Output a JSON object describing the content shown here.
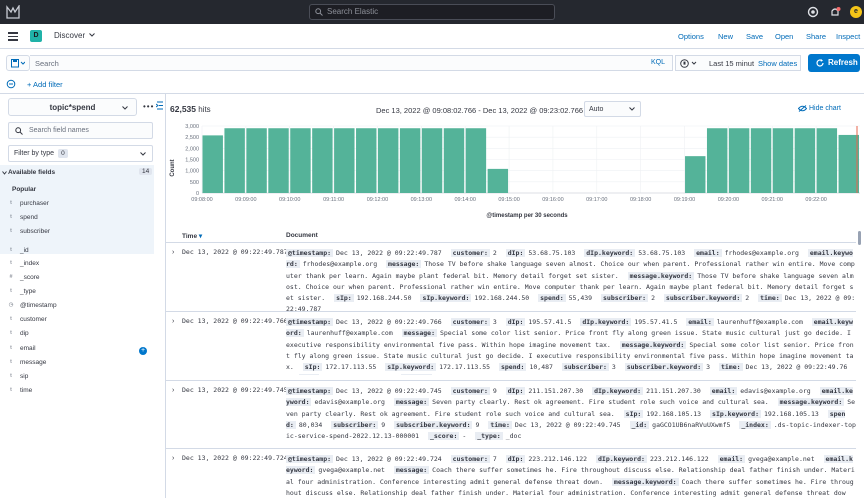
{
  "topbar": {
    "search_placeholder": "Search Elastic",
    "avatar_letter": "e"
  },
  "appbar": {
    "space_letter": "D",
    "title": "Discover",
    "links": [
      "Options",
      "New",
      "Save",
      "Open",
      "Share",
      "Inspect"
    ]
  },
  "querybar": {
    "search_placeholder": "Search",
    "language": "KQL",
    "date_label": "Last 15 minut",
    "show_dates": "Show dates",
    "refresh": "Refresh",
    "add_filter": "+ Add filter"
  },
  "sidebar": {
    "index_pattern": "topic*spend",
    "field_search_placeholder": "Search field names",
    "filter_by_type": "Filter by type",
    "filter_count": "0",
    "available_fields": "Available fields",
    "available_count": "14",
    "popular": "Popular",
    "popular_fields": [
      {
        "type": "t",
        "name": "purchaser"
      },
      {
        "type": "t",
        "name": "spend"
      },
      {
        "type": "t",
        "name": "subscriber"
      }
    ],
    "fields": [
      {
        "type": "t",
        "name": "_id"
      },
      {
        "type": "t",
        "name": "_index"
      },
      {
        "type": "#",
        "name": "_score"
      },
      {
        "type": "t",
        "name": "_type"
      },
      {
        "type": "◷",
        "name": "@timestamp"
      },
      {
        "type": "t",
        "name": "customer"
      },
      {
        "type": "t",
        "name": "dip"
      },
      {
        "type": "t",
        "name": "email"
      },
      {
        "type": "t",
        "name": "message"
      },
      {
        "type": "t",
        "name": "sip"
      },
      {
        "type": "t",
        "name": "time"
      }
    ]
  },
  "main": {
    "hits_count": "62,535",
    "hits_label": " hits",
    "time_range": "Dec 13, 2022 @ 09:08:02.766 - Dec 13, 2022 @ 09:23:02.766",
    "interval": "Auto",
    "hide_chart": "Hide chart",
    "col_time": "Time",
    "col_document": "Document"
  },
  "chart_data": {
    "type": "bar",
    "xlabel": "@timestamp per 30 seconds",
    "ylabel": "Count",
    "ylim": [
      0,
      3000
    ],
    "yticks": [
      "0",
      "500",
      "1,000",
      "1,500",
      "2,000",
      "2,500",
      "3,000"
    ],
    "xticks": [
      "09:08:00",
      "09:09:00",
      "09:10:00",
      "09:11:00",
      "09:12:00",
      "09:13:00",
      "09:14:00",
      "09:15:00",
      "09:16:00",
      "09:17:00",
      "09:18:00",
      "09:19:00",
      "09:20:00",
      "09:21:00",
      "09:22:00"
    ],
    "start_label": "09:08:00",
    "bar_width_minutes": 0.5,
    "bars": [
      {
        "t": 0.0,
        "v": 2580
      },
      {
        "t": 0.5,
        "v": 2900
      },
      {
        "t": 1.0,
        "v": 2900
      },
      {
        "t": 1.5,
        "v": 2900
      },
      {
        "t": 2.0,
        "v": 2900
      },
      {
        "t": 2.5,
        "v": 2900
      },
      {
        "t": 3.0,
        "v": 2900
      },
      {
        "t": 3.5,
        "v": 2900
      },
      {
        "t": 4.0,
        "v": 2900
      },
      {
        "t": 4.5,
        "v": 2900
      },
      {
        "t": 5.0,
        "v": 2900
      },
      {
        "t": 5.5,
        "v": 2900
      },
      {
        "t": 6.0,
        "v": 2900
      },
      {
        "t": 6.5,
        "v": 1080
      },
      {
        "t": 11.0,
        "v": 1650
      },
      {
        "t": 11.5,
        "v": 2900
      },
      {
        "t": 12.0,
        "v": 2900
      },
      {
        "t": 12.5,
        "v": 2900
      },
      {
        "t": 13.0,
        "v": 2900
      },
      {
        "t": 13.5,
        "v": 2900
      },
      {
        "t": 14.0,
        "v": 2900
      },
      {
        "t": 14.5,
        "v": 2600
      }
    ],
    "colors": {
      "bar": "#54b399",
      "now_line": "#e7664c"
    }
  },
  "documents": [
    {
      "time": "Dec 13, 2022 @ 09:22:49.787",
      "fields": [
        [
          "@timestamp:",
          "Dec 13, 2022 @ 09:22:49.787"
        ],
        [
          "customer:",
          "2"
        ],
        [
          "dIp:",
          "53.68.75.103"
        ],
        [
          "dIp.keyword:",
          "53.68.75.103"
        ],
        [
          "email:",
          "frhodes@example.org"
        ],
        [
          "email.keyword:",
          "frhodes@example.org"
        ],
        [
          "message:",
          "Those TV before shake language seven almost. Choice our when parent. Professional rather win entire. Move computer thank per learn. Again maybe plant federal bit. Memory detail forget set sister."
        ],
        [
          "message.keyword:",
          "Those TV before shake language seven almost. Choice our when parent. Professional rather win entire. Move computer thank per learn. Again maybe plant federal bit. Memory detail forget set sister."
        ],
        [
          "sIp:",
          "192.168.244.50"
        ],
        [
          "sIp.keyword:",
          "192.168.244.50"
        ],
        [
          "spend:",
          "55,439"
        ],
        [
          "subscriber:",
          "2"
        ],
        [
          "subscriber.keyword:",
          "2"
        ],
        [
          "time:",
          "Dec 13, 2022 @ 09:22:49.787"
        ]
      ]
    },
    {
      "time": "Dec 13, 2022 @ 09:22:49.766",
      "fields": [
        [
          "@timestamp:",
          "Dec 13, 2022 @ 09:22:49.766"
        ],
        [
          "customer:",
          "3"
        ],
        [
          "dIp:",
          "195.57.41.5"
        ],
        [
          "dIp.keyword:",
          "195.57.41.5"
        ],
        [
          "email:",
          "laurenhuff@example.com"
        ],
        [
          "email.keyword:",
          "laurenhuff@example.com"
        ],
        [
          "message:",
          "Special some color list senior. Price front fly along green issue. State music cultural just go decide. I executive responsibility environmental five pass. Within hope imagine movement tax."
        ],
        [
          "message.keyword:",
          "Special some color list senior. Price front fly along green issue. State music cultural just go decide. I executive responsibility environmental five pass. Within hope imagine movement tax."
        ],
        [
          "sIp:",
          "172.17.113.55"
        ],
        [
          "sIp.keyword:",
          "172.17.113.55"
        ],
        [
          "spend:",
          "10,487"
        ],
        [
          "subscriber:",
          "3"
        ],
        [
          "subscriber.keyword:",
          "3"
        ],
        [
          "time:",
          "Dec 13, 2022 @ 09:22:49.766"
        ],
        [
          "_id:",
          "gcGCO1UBbNWVuXwmT5"
        ],
        [
          "_index:",
          ".ds-"
        ]
      ]
    },
    {
      "time": "Dec 13, 2022 @ 09:22:49.745",
      "fields": [
        [
          "@timestamp:",
          "Dec 13, 2022 @ 09:22:49.745"
        ],
        [
          "customer:",
          "9"
        ],
        [
          "dIp:",
          "211.151.207.30"
        ],
        [
          "dIp.keyword:",
          "211.151.207.30"
        ],
        [
          "email:",
          "edavis@example.org"
        ],
        [
          "email.keyword:",
          "edavis@example.org"
        ],
        [
          "message:",
          "Seven party clearly. Rest ok agreement. Fire student role such voice and cultural sea."
        ],
        [
          "message.keyword:",
          "Seven party clearly. Rest ok agreement. Fire student role such voice and cultural sea."
        ],
        [
          "sIp:",
          "192.168.105.13"
        ],
        [
          "sIp.keyword:",
          "192.168.105.13"
        ],
        [
          "spend:",
          "80,034"
        ],
        [
          "subscriber:",
          "9"
        ],
        [
          "subscriber.keyword:",
          "9"
        ],
        [
          "time:",
          "Dec 13, 2022 @ 09:22:49.745"
        ],
        [
          "_id:",
          "gaGCO1UB6naRVuUXwmf5"
        ],
        [
          "_index:",
          ".ds-topic-indexer-topic-service-spend-2022.12.13-000001"
        ],
        [
          "_score:",
          "-"
        ],
        [
          "_type:",
          "_doc"
        ]
      ]
    },
    {
      "time": "Dec 13, 2022 @ 09:22:49.724",
      "fields": [
        [
          "@timestamp:",
          "Dec 13, 2022 @ 09:22:49.724"
        ],
        [
          "customer:",
          "7"
        ],
        [
          "dIp:",
          "223.212.146.122"
        ],
        [
          "dIp.keyword:",
          "223.212.146.122"
        ],
        [
          "email:",
          "gvega@example.net"
        ],
        [
          "email.keyword:",
          "gvega@example.net"
        ],
        [
          "message:",
          "Coach there suffer sometimes he. Fire throughout discuss else. Relationship deal father finish under. Material four administration. Conference interesting admit general defense threat down."
        ],
        [
          "message.keyword:",
          "Coach there suffer sometimes he. Fire throughout discuss else. Relationship deal father finish under. Material four administration. Conference interesting admit general defense threat down."
        ],
        [
          "sIp:",
          "192.168.210.75"
        ]
      ]
    }
  ]
}
